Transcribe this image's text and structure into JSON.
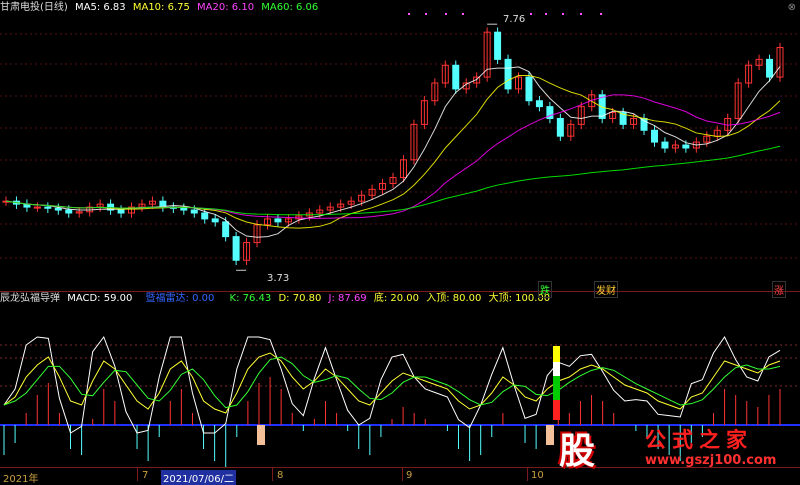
{
  "main_legend": {
    "stock": "甘肃电投(日线)",
    "ma5": "MA5: 6.83",
    "ma10": "MA10: 6.75",
    "ma20": "MA20: 6.10",
    "ma60": "MA60: 6.06"
  },
  "indicator_legend": {
    "name": "辰龙弘福导弹",
    "macd": "MACD: 59.00",
    "zhuli": "暨福雷达: 0.00",
    "k": "K: 76.43",
    "d": "D: 70.80",
    "j": "J: 87.69",
    "di": "底: 20.00",
    "rudi": "入顶: 80.00",
    "dading": "大顶: 100.00"
  },
  "price_annotations": {
    "high": "7.76",
    "low": "3.73"
  },
  "signal_tags": {
    "die": "跌",
    "fa_cai": "发财",
    "zhang": "涨"
  },
  "time_axis": {
    "labels": [
      "2021年",
      "7",
      "2021/07/06/二",
      "8",
      "9",
      "10"
    ]
  },
  "logo": {
    "mark": "股",
    "title": "公式之家",
    "url": "www.gszj100.com"
  },
  "colors": {
    "up": "#ff3232",
    "down": "#54ffff",
    "ma5": "#ffffff",
    "ma10": "#ffff00",
    "ma20": "#ff00ff",
    "ma60": "#00ff00"
  },
  "chart_data": {
    "type": "candlestick",
    "price_series": [
      4.9,
      4.85,
      4.8,
      4.8,
      4.78,
      4.75,
      4.7,
      4.72,
      4.8,
      4.85,
      4.75,
      4.7,
      4.8,
      4.85,
      4.9,
      4.8,
      4.78,
      4.75,
      4.7,
      4.6,
      4.55,
      4.3,
      3.9,
      4.2,
      4.5,
      4.6,
      4.55,
      4.6,
      4.65,
      4.7,
      4.75,
      4.8,
      4.85,
      4.9,
      5.0,
      5.1,
      5.2,
      5.3,
      5.6,
      6.2,
      6.6,
      6.9,
      7.2,
      6.8,
      6.9,
      7.0,
      7.76,
      7.3,
      6.8,
      7.0,
      6.6,
      6.5,
      6.3,
      6.0,
      6.2,
      6.5,
      6.7,
      6.3,
      6.4,
      6.2,
      6.3,
      6.1,
      5.9,
      5.8,
      5.85,
      5.8,
      5.9,
      6.0,
      6.1,
      6.3,
      6.9,
      7.2,
      7.3,
      7.0,
      7.5
    ],
    "kdj_k": [
      25,
      35,
      60,
      75,
      85,
      60,
      30,
      25,
      55,
      80,
      70,
      50,
      30,
      20,
      40,
      70,
      80,
      60,
      30,
      20,
      15,
      40,
      70,
      85,
      90,
      80,
      60,
      45,
      55,
      70,
      60,
      45,
      30,
      25,
      40,
      55,
      65,
      60,
      55,
      50,
      45,
      30,
      20,
      25,
      40,
      60,
      50,
      35,
      30,
      45,
      55,
      60,
      70,
      75,
      70,
      60,
      50,
      45,
      40,
      30,
      25,
      20,
      35,
      40,
      60,
      80,
      75,
      70,
      65,
      75,
      80
    ]
  }
}
